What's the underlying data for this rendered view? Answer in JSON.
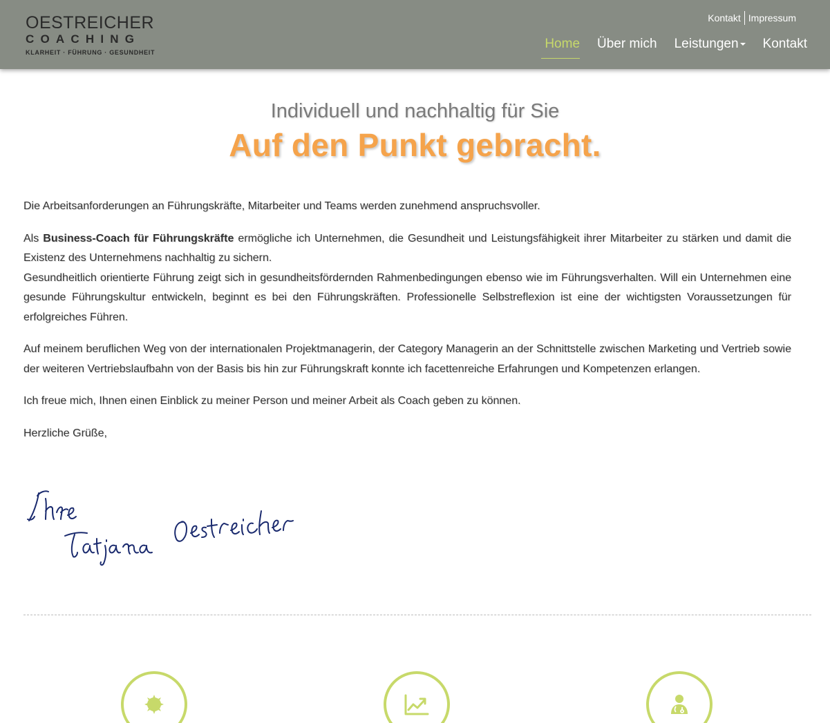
{
  "header": {
    "logo": {
      "line1": "OESTREICHER",
      "line2": "COACHING",
      "tagline": "KLARHEIT · FÜHRUNG · GESUNDHEIT"
    },
    "top_links": [
      "Kontakt",
      "Impressum"
    ],
    "nav": {
      "home": "Home",
      "about": "Über mich",
      "services": "Leistungen",
      "contact": "Kontakt"
    },
    "active_nav": "Home",
    "accent_color": "#c7d96a",
    "bar_color": "#878c84"
  },
  "hero": {
    "subtitle": "Individuell und nachhaltig für Sie",
    "title": "Auf den Punkt gebracht.",
    "title_color": "#f5a34b"
  },
  "content": {
    "p1": "Die Arbeitsanforderungen an Führungskräfte, Mitarbeiter und Teams werden zunehmend anspruchsvoller.",
    "p2_prefix": "Als ",
    "p2_bold": "Business-Coach für Führungskräfte",
    "p2_rest": " ermögliche ich Unternehmen, die Gesundheit und Leistungsfähigkeit ihrer Mitarbeiter zu stärken und damit die Existenz des Unternehmens nachhaltig zu sichern.",
    "p2_line2": "Gesundheitlich orientierte Führung zeigt sich in gesundheitsfördernden Rahmenbedingungen ebenso wie im Führungsverhalten. Will ein Unternehmen eine gesunde Führungskultur entwickeln, beginnt es bei den Führungskräften. Professionelle Selbstreflexion ist eine der wichtigsten Voraussetzungen für erfolgreiches Führen.",
    "p3": "Auf meinem beruflichen Weg von der internationalen Projektmanagerin, der Category Managerin an der Schnittstelle zwischen Marketing und Vertrieb sowie der weiteren Vertriebslaufbahn von der Basis bis hin zur Führungskraft konnte ich facettenreiche Erfahrungen und Kompetenzen erlangen.",
    "p4": "Ich freue mich, Ihnen einen Einblick zu meiner Person und meiner Arbeit als Coach geben zu können.",
    "greeting": "Herzliche Grüße,"
  },
  "signature": {
    "text": "Ihre Tatjana Oestreicher",
    "ink_color": "#1a2a6e"
  },
  "features": [
    {
      "icon": "gear-icon"
    },
    {
      "icon": "chart-up-icon"
    },
    {
      "icon": "doctor-icon"
    }
  ]
}
